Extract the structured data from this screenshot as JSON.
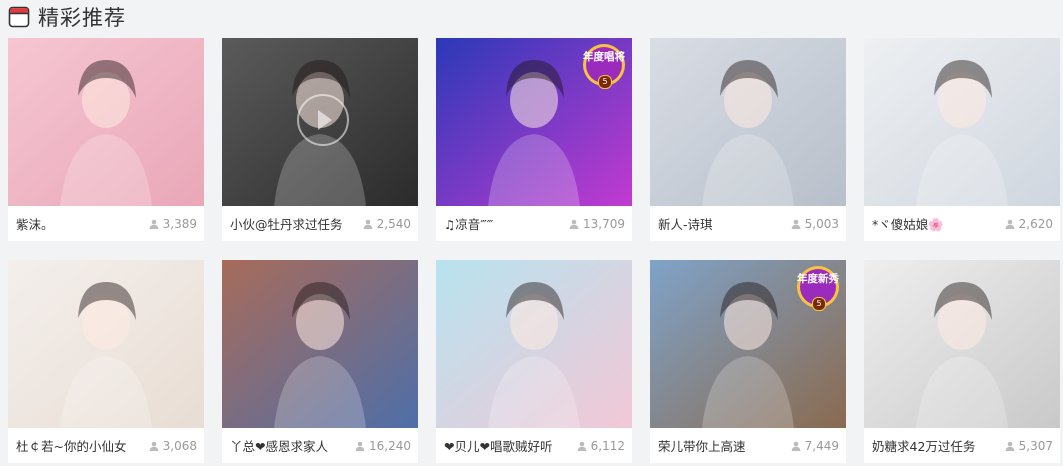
{
  "section": {
    "title": "精彩推荐",
    "icon": "tv-icon",
    "accent": "#e4393c"
  },
  "rooms": [
    {
      "name": "紫沫。",
      "viewers": "3,389",
      "badge": null,
      "theme": [
        "#f6c6d2",
        "#e9a7b8"
      ]
    },
    {
      "name": "小伙@牡丹求过任务",
      "viewers": "2,540",
      "badge": null,
      "theme": [
        "#5b5b5b",
        "#2b2b2b"
      ],
      "play": true
    },
    {
      "name": "♫凉音‴‴",
      "viewers": "13,709",
      "badge": {
        "text": "年度唱将",
        "num": "5"
      },
      "theme": [
        "#2a39b8",
        "#c33ad1"
      ]
    },
    {
      "name": "新人-诗琪",
      "viewers": "5,003",
      "badge": null,
      "theme": [
        "#d9dde4",
        "#b7bfca"
      ]
    },
    {
      "name": "*ヾ傻姑娘🌸",
      "viewers": "2,620",
      "badge": null,
      "theme": [
        "#eef0f2",
        "#cfd6df"
      ]
    },
    {
      "name": "杜￠若~你的小仙女",
      "viewers": "3,068",
      "badge": null,
      "theme": [
        "#f4efec",
        "#e8ddd4"
      ]
    },
    {
      "name": "丫总❤感恩求家人",
      "viewers": "16,240",
      "badge": null,
      "theme": [
        "#a86b5a",
        "#4e6fa8"
      ]
    },
    {
      "name": "❤贝儿❤唱歌贼好听",
      "viewers": "6,112",
      "badge": null,
      "theme": [
        "#b7e3ef",
        "#f2c7d6"
      ]
    },
    {
      "name": "荣儿带你上高速",
      "viewers": "7,449",
      "badge": {
        "text": "年度新秀",
        "num": "5"
      },
      "theme": [
        "#7fa3c9",
        "#8a6a4f"
      ]
    },
    {
      "name": "奶糖求42万过任务",
      "viewers": "5,307",
      "badge": null,
      "theme": [
        "#eeeeee",
        "#c9c9c9"
      ]
    }
  ]
}
